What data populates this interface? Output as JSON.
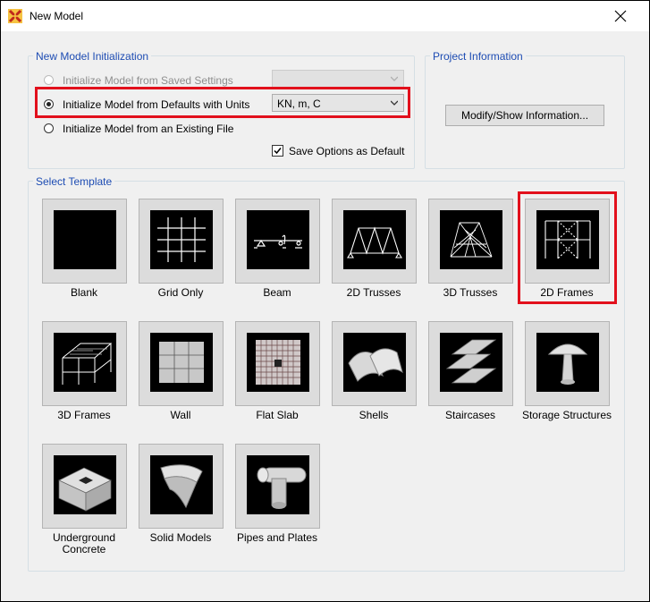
{
  "window": {
    "title": "New Model"
  },
  "init_group": {
    "label": "New Model Initialization",
    "options": [
      {
        "label": "Initialize Model from Saved Settings",
        "enabled": false,
        "selected": false
      },
      {
        "label": "Initialize Model from Defaults with Units",
        "enabled": true,
        "selected": true
      },
      {
        "label": "Initialize Model from an Existing File",
        "enabled": true,
        "selected": false
      }
    ],
    "units_value": "KN, m, C",
    "save_default_label": "Save Options as Default",
    "save_default_checked": true
  },
  "project_group": {
    "label": "Project Information",
    "button_label": "Modify/Show Information..."
  },
  "template_group": {
    "label": "Select Template",
    "templates": [
      {
        "label": "Blank",
        "icon": "blank-template-icon"
      },
      {
        "label": "Grid Only",
        "icon": "grid-template-icon"
      },
      {
        "label": "Beam",
        "icon": "beam-template-icon"
      },
      {
        "label": "2D Trusses",
        "icon": "2d-truss-template-icon"
      },
      {
        "label": "3D Trusses",
        "icon": "3d-truss-template-icon"
      },
      {
        "label": "2D Frames",
        "icon": "2d-frame-template-icon",
        "highlighted": true
      },
      {
        "label": "3D Frames",
        "icon": "3d-frame-template-icon"
      },
      {
        "label": "Wall",
        "icon": "wall-template-icon"
      },
      {
        "label": "Flat Slab",
        "icon": "flat-slab-template-icon"
      },
      {
        "label": "Shells",
        "icon": "shells-template-icon"
      },
      {
        "label": "Staircases",
        "icon": "staircase-template-icon"
      },
      {
        "label": "Storage Structures",
        "icon": "storage-structure-template-icon"
      },
      {
        "label": "Underground Concrete",
        "label_line1": "Underground",
        "label_line2": "Concrete",
        "icon": "underground-concrete-template-icon"
      },
      {
        "label": "Solid Models",
        "icon": "solid-model-template-icon"
      },
      {
        "label": "Pipes and Plates",
        "icon": "pipes-plates-template-icon"
      }
    ]
  },
  "colors": {
    "accent_label": "#1d4cb3",
    "highlight": "#e2101c",
    "tile_bg": "#dcdcdc"
  }
}
